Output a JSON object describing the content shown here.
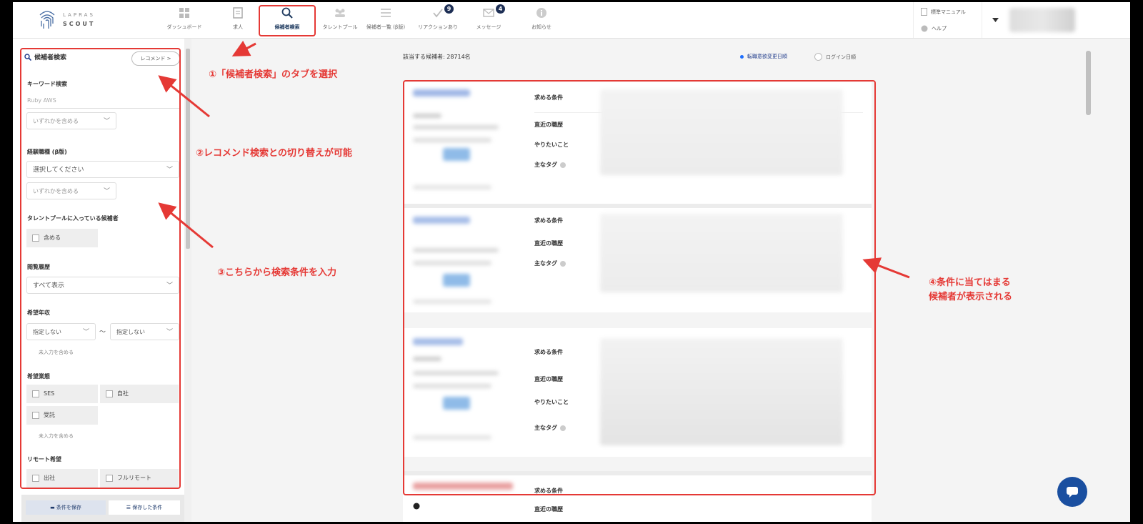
{
  "logo": {
    "line1": "LAPRAS",
    "line2": "SCOUT"
  },
  "nav": [
    {
      "label": "ダッシュボード",
      "icon": "dashboard-icon"
    },
    {
      "label": "求人",
      "icon": "document-icon"
    },
    {
      "label": "候補者検索",
      "icon": "search-icon",
      "active": true
    },
    {
      "label": "タレントプール",
      "icon": "people-icon"
    },
    {
      "label": "候補者一覧 (β版)",
      "icon": "list-icon"
    },
    {
      "label": "リアクションあり",
      "icon": "check-icon",
      "badge": "9"
    },
    {
      "label": "メッセージ",
      "icon": "mail-icon",
      "badge": "4"
    },
    {
      "label": "お知らせ",
      "icon": "info-icon"
    }
  ],
  "header_links": {
    "manual": "標準マニュアル",
    "help": "ヘルプ"
  },
  "sidebar": {
    "title": "候補者検索",
    "recommend_button": "レコメンド >",
    "keyword_label": "キーワード検索",
    "keyword_placeholder": "Ruby AWS",
    "keyword_match": "いずれかを含める",
    "job_label": "経験職種 (β版)",
    "job_select": "選択してください",
    "job_match": "いずれかを含める",
    "talent_label": "タレントプールに入っている候補者",
    "talent_option": "含める",
    "history_label": "閲覧履歴",
    "history_select": "すべて表示",
    "salary_label": "希望年収",
    "salary_min": "指定しない",
    "salary_tilde": "〜",
    "salary_max": "指定しない",
    "salary_empty": "未入力を含める",
    "industry_label": "希望業態",
    "industry_options": [
      "SES",
      "自社",
      "受託"
    ],
    "industry_empty": "未入力を含める",
    "remote_label": "リモート希望",
    "remote_options": [
      "出社",
      "フルリモート"
    ],
    "save_condition": "条件を保存",
    "saved_conditions": "保存した条件"
  },
  "main": {
    "count_text": "該当する候補者: 28714名",
    "sort_options": [
      "転職意欲変更日順",
      "ログイン日順"
    ],
    "fields": {
      "wants": "求める条件",
      "recent": "直近の職歴",
      "todo": "やりたいこと",
      "tags": "主なタグ"
    }
  },
  "annotations": {
    "step1": "①「候補者検索」のタブを選択",
    "step2": "②レコメンド検索との切り替えが可能",
    "step3": "③こちらから検索条件を入力",
    "step4_line1": "④条件に当てはまる",
    "step4_line2": "候補者が表示される"
  },
  "colors": {
    "accent": "#1e3a5f",
    "annotation": "#e53935",
    "chat": "#1a4fa0"
  }
}
